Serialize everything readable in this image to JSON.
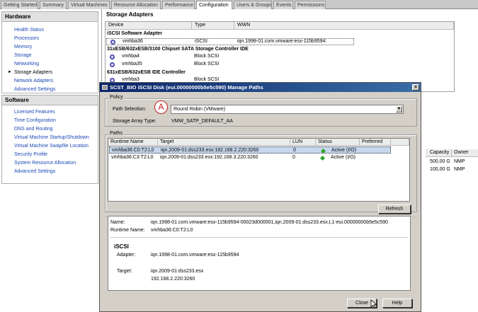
{
  "tabs": [
    {
      "label": "Getting Started",
      "active": false
    },
    {
      "label": "Summary",
      "active": false
    },
    {
      "label": "Virtual Machines",
      "active": false
    },
    {
      "label": "Resource Allocation",
      "active": false
    },
    {
      "label": "Performance",
      "active": false
    },
    {
      "label": "Configuration",
      "active": true
    },
    {
      "label": "Users & Groups",
      "active": false
    },
    {
      "label": "Events",
      "active": false
    },
    {
      "label": "Permissions",
      "active": false
    }
  ],
  "hardware": {
    "title": "Hardware",
    "items": [
      "Health Status",
      "Processors",
      "Memory",
      "Storage",
      "Networking",
      "Storage Adapters",
      "Network Adapters",
      "Advanced Settings"
    ],
    "selected": "Storage Adapters"
  },
  "software": {
    "title": "Software",
    "items": [
      "Licensed Features",
      "Time Configuration",
      "DNS and Routing",
      "Virtual Machine Startup/Shutdown",
      "Virtual Machine Swapfile Location",
      "Security Profile",
      "System Resource Allocation",
      "Advanced Settings"
    ]
  },
  "storage_adapters": {
    "title": "Storage Adapters",
    "columns": [
      "Device",
      "Type",
      "WWN"
    ],
    "groups": [
      {
        "name": "iSCSI Software Adapter",
        "rows": [
          {
            "device": "vmhba36",
            "type": "iSCSI",
            "wwn": "iqn.1998-01.com.vmware:esx-115b9594:"
          }
        ]
      },
      {
        "name": "31xESB/632xESB/3100 Chipset SATA Storage Controller IDE",
        "rows": [
          {
            "device": "vmhba4",
            "type": "Block SCSI",
            "wwn": ""
          },
          {
            "device": "vmhba35",
            "type": "Block SCSI",
            "wwn": ""
          }
        ]
      },
      {
        "name": "631xESB/632xESB IDE Controller",
        "rows": [
          {
            "device": "vmhba3",
            "type": "Block SCSI",
            "wwn": ""
          }
        ]
      }
    ]
  },
  "right_grid": {
    "columns": [
      "Capacity",
      "Owner"
    ],
    "rows": [
      [
        "500,00 G",
        "NMP"
      ],
      [
        "100,00 G",
        "NMP"
      ]
    ]
  },
  "dialog": {
    "title": "SCST_BIO iSCSI Disk (eui.00000000b5e5c590) Manage Paths",
    "policy": {
      "group_label": "Policy",
      "path_selection_label": "Path Selection:",
      "path_selection_value": "Round Robin (VMware)",
      "sat_label": "Storage Array Type:",
      "sat_value": "VMW_SATP_DEFAULT_AA"
    },
    "annotation": "A",
    "paths": {
      "group_label": "Paths",
      "columns": [
        "Runtime Name",
        "Target",
        "LUN",
        "Status",
        "Preferred"
      ],
      "rows": [
        {
          "runtime": "vmhba36:C0:T2:L0",
          "target": "iqn.2009-01:dss233.esx:192.168.2.220:3260",
          "lun": "0",
          "status": "Active (I/O)",
          "preferred": ""
        },
        {
          "runtime": "vmhba36:C3:T2:L0",
          "target": "iqn.2009-01:dss233.esx:192.168.3.220:3260",
          "lun": "0",
          "status": "Active (I/O)",
          "preferred": ""
        }
      ],
      "refresh_label": "Refresh"
    },
    "details": {
      "name_label": "Name:",
      "name_value": "iqn.1998-01.com.vmware:esx-115b9594-00023d000001,iqn.2009-01:dss233.esx,t,1-eui.00000000b5e5c590",
      "runtime_label": "Runtime Name:",
      "runtime_value": "vmhba36:C0:T2:L0",
      "section": "iSCSI",
      "adapter_label": "Adapter:",
      "adapter_value": "iqn.1998-01.com.vmware:esx-115b9594",
      "target_label": "Target:",
      "target_value1": "iqn.2009-01:dss233.esx",
      "target_value2": "192.168.2.220:3260"
    },
    "close_label": "Close",
    "help_label": "Help"
  },
  "colors": {
    "title_bar": "#0a246a",
    "link": "#1b49b5",
    "active_status": "#2fa52f",
    "annotation": "#c21d1d"
  }
}
